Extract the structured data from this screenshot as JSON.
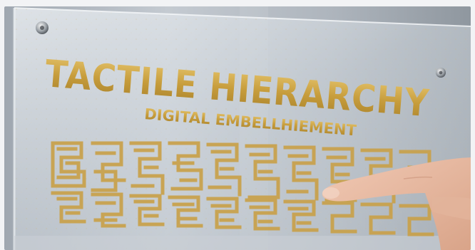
{
  "sign": {
    "title": "TACTILE HIERARCHY",
    "subtitle": "DIGITAL EMBELLHIEMENT"
  },
  "colors": {
    "gold": "#c49a3a",
    "gold_light": "#e0bf6a",
    "background": "#b9bfc6",
    "acrylic": "#dfe4ea"
  },
  "scene": {
    "elements": [
      "acrylic-panel",
      "standoff-screw-icon",
      "maze-pattern",
      "pointing-hand"
    ]
  }
}
